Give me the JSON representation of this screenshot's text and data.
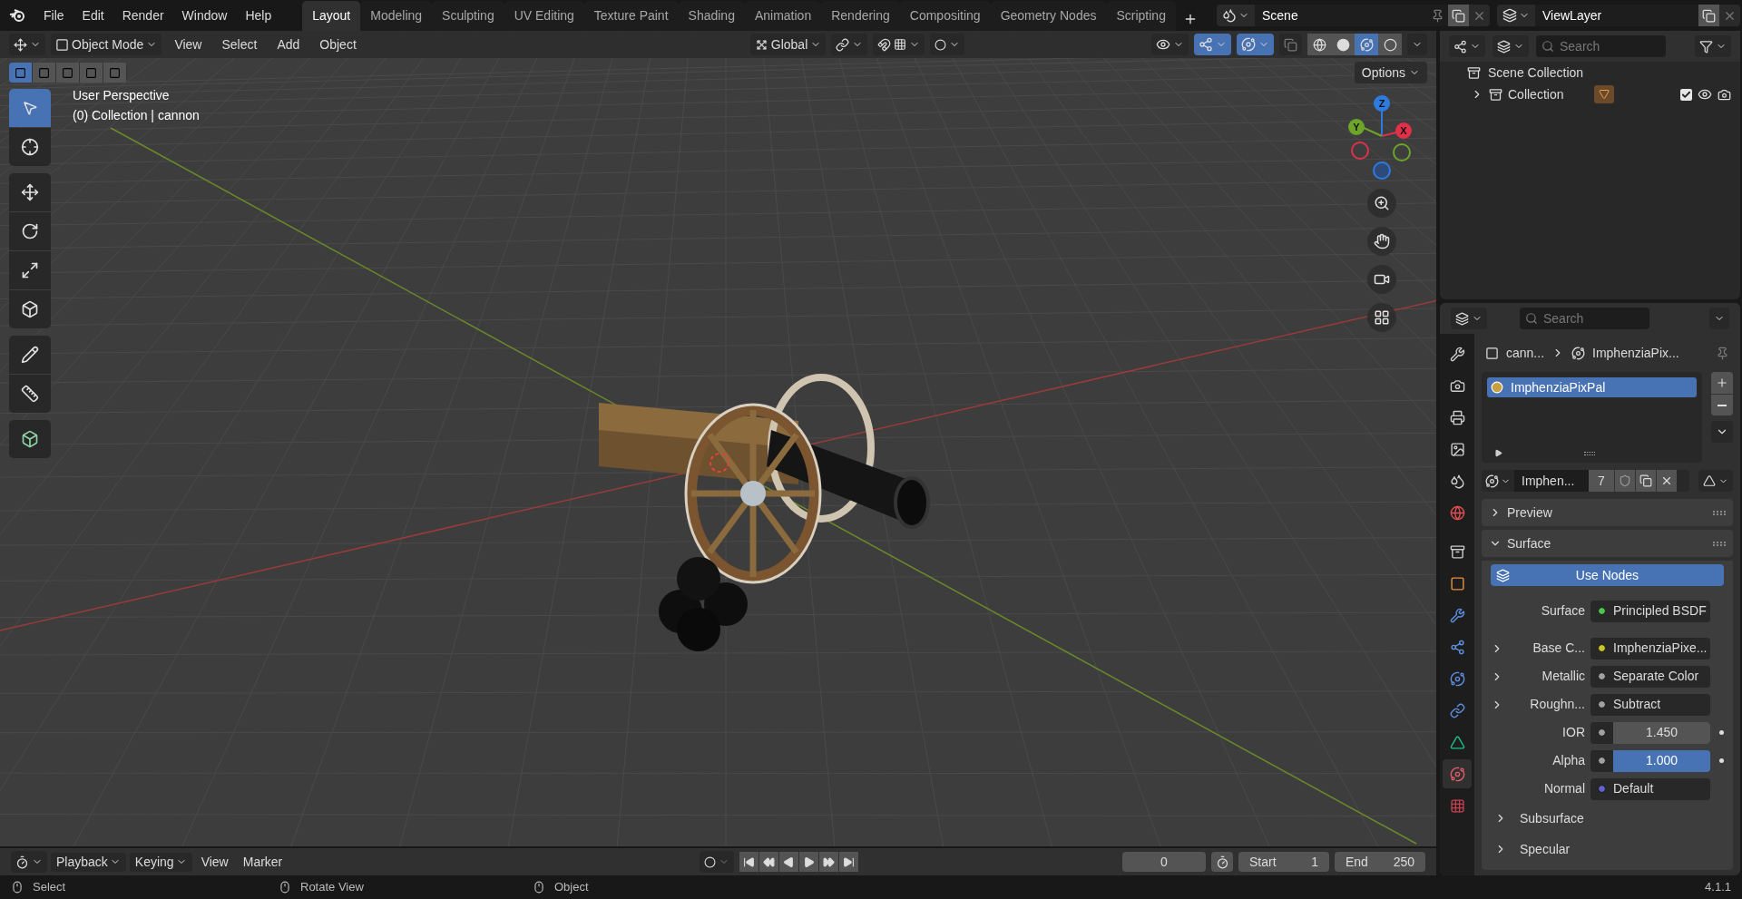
{
  "menu": [
    "File",
    "Edit",
    "Render",
    "Window",
    "Help"
  ],
  "workspaces": [
    {
      "label": "Layout",
      "selected": true
    },
    {
      "label": "Modeling",
      "selected": false
    },
    {
      "label": "Sculpting",
      "selected": false
    },
    {
      "label": "UV Editing",
      "selected": false
    },
    {
      "label": "Texture Paint",
      "selected": false
    },
    {
      "label": "Shading",
      "selected": false
    },
    {
      "label": "Animation",
      "selected": false
    },
    {
      "label": "Rendering",
      "selected": false
    },
    {
      "label": "Compositing",
      "selected": false
    },
    {
      "label": "Geometry Nodes",
      "selected": false
    },
    {
      "label": "Scripting",
      "selected": false
    }
  ],
  "scene": {
    "name": "Scene"
  },
  "view_layer": {
    "name": "ViewLayer"
  },
  "viewport_header": {
    "mode": "Object Mode",
    "menus": [
      "View",
      "Select",
      "Add",
      "Object"
    ],
    "orientation": "Global",
    "gizmos_on": true,
    "overlays_on": true,
    "options": "Options"
  },
  "shading_modes": [
    {
      "selected": false
    },
    {
      "selected": false
    },
    {
      "selected": true
    },
    {
      "selected": false
    }
  ],
  "select_modes": [
    {
      "selected": true
    },
    {
      "selected": false
    },
    {
      "selected": false
    },
    {
      "selected": false
    },
    {
      "selected": false
    }
  ],
  "tool_groups": [
    [
      {
        "selected": true
      },
      {
        "selected": false
      }
    ],
    [
      {
        "selected": false
      },
      {
        "selected": false
      },
      {
        "selected": false
      },
      {
        "selected": false
      }
    ],
    [
      {
        "selected": false
      },
      {
        "selected": false
      }
    ],
    [
      {
        "selected": false
      }
    ]
  ],
  "viewport_info": {
    "title": "User Perspective",
    "context": "(0) Collection | cannon"
  },
  "gizmo_axes": [
    {
      "label": "Z",
      "color": "#2e7be0"
    },
    {
      "label": "Y",
      "color": "#6da52a"
    },
    {
      "label": "X",
      "color": "#e0304a"
    }
  ],
  "outliner": {
    "search_placeholder": "Search",
    "items": [
      {
        "label": "Scene Collection",
        "children": [
          {
            "label": "Collection",
            "expanded": false,
            "checked": true
          }
        ]
      }
    ]
  },
  "properties": {
    "search_placeholder": "Search",
    "breadcrumb": [
      "cann...",
      "ImphenziaPix..."
    ],
    "tabs": [
      {
        "selected": false
      },
      {
        "selected": false
      },
      {
        "selected": false
      },
      {
        "selected": false
      },
      {
        "selected": false
      },
      {
        "selected": false
      },
      {
        "selected": false
      },
      {
        "selected": false
      },
      {
        "selected": false
      },
      {
        "selected": false
      },
      {
        "selected": false
      },
      {
        "selected": false
      },
      {
        "selected": false
      },
      {
        "selected": true
      },
      {
        "selected": false
      }
    ],
    "material_slots": [
      {
        "label": "ImphenziaPixPal",
        "selected": true
      }
    ],
    "material": {
      "name": "Imphen...",
      "users": "7"
    },
    "panels": [
      {
        "label": "Preview",
        "expanded": false
      },
      {
        "label": "Surface",
        "expanded": true
      }
    ],
    "use_nodes": "Use Nodes",
    "inputs": [
      {
        "label": "Surface",
        "value": "Principled BSDF",
        "kind": "link",
        "color": "#4fc44f",
        "expandable": false
      },
      {
        "label": "Base C...",
        "value": "ImphenziaPixe...",
        "kind": "link",
        "color": "#c7c729",
        "expandable": true
      },
      {
        "label": "Metallic",
        "value": "Separate Color",
        "kind": "link",
        "color": "#a1a1a1",
        "expandable": true
      },
      {
        "label": "Roughn...",
        "value": "Subtract",
        "kind": "link",
        "color": "#a1a1a1",
        "expandable": true
      },
      {
        "label": "IOR",
        "value": "1.450",
        "kind": "number",
        "color": "#a1a1a1",
        "expandable": false
      },
      {
        "label": "Alpha",
        "value": "1.000",
        "kind": "slider",
        "level": 1,
        "color": "#a1a1a1",
        "expandable": false
      },
      {
        "label": "Normal",
        "value": "Default",
        "kind": "link",
        "color": "#6363c7",
        "expandable": false
      }
    ],
    "subpanels": [
      {
        "label": "Subsurface",
        "expanded": false
      },
      {
        "label": "Specular",
        "expanded": false
      }
    ]
  },
  "timeline": {
    "menus": [
      {
        "label": "Playback",
        "dropdown": true
      },
      {
        "label": "Keying",
        "dropdown": true
      },
      {
        "label": "View",
        "dropdown": false
      },
      {
        "label": "Marker",
        "dropdown": false
      }
    ],
    "current_frame": "0",
    "start_label": "Start",
    "start": "1",
    "end_label": "End",
    "end": "250"
  },
  "status_bar": {
    "items": [
      "Select",
      "Rotate View",
      "Object"
    ],
    "version": "4.1.1"
  }
}
